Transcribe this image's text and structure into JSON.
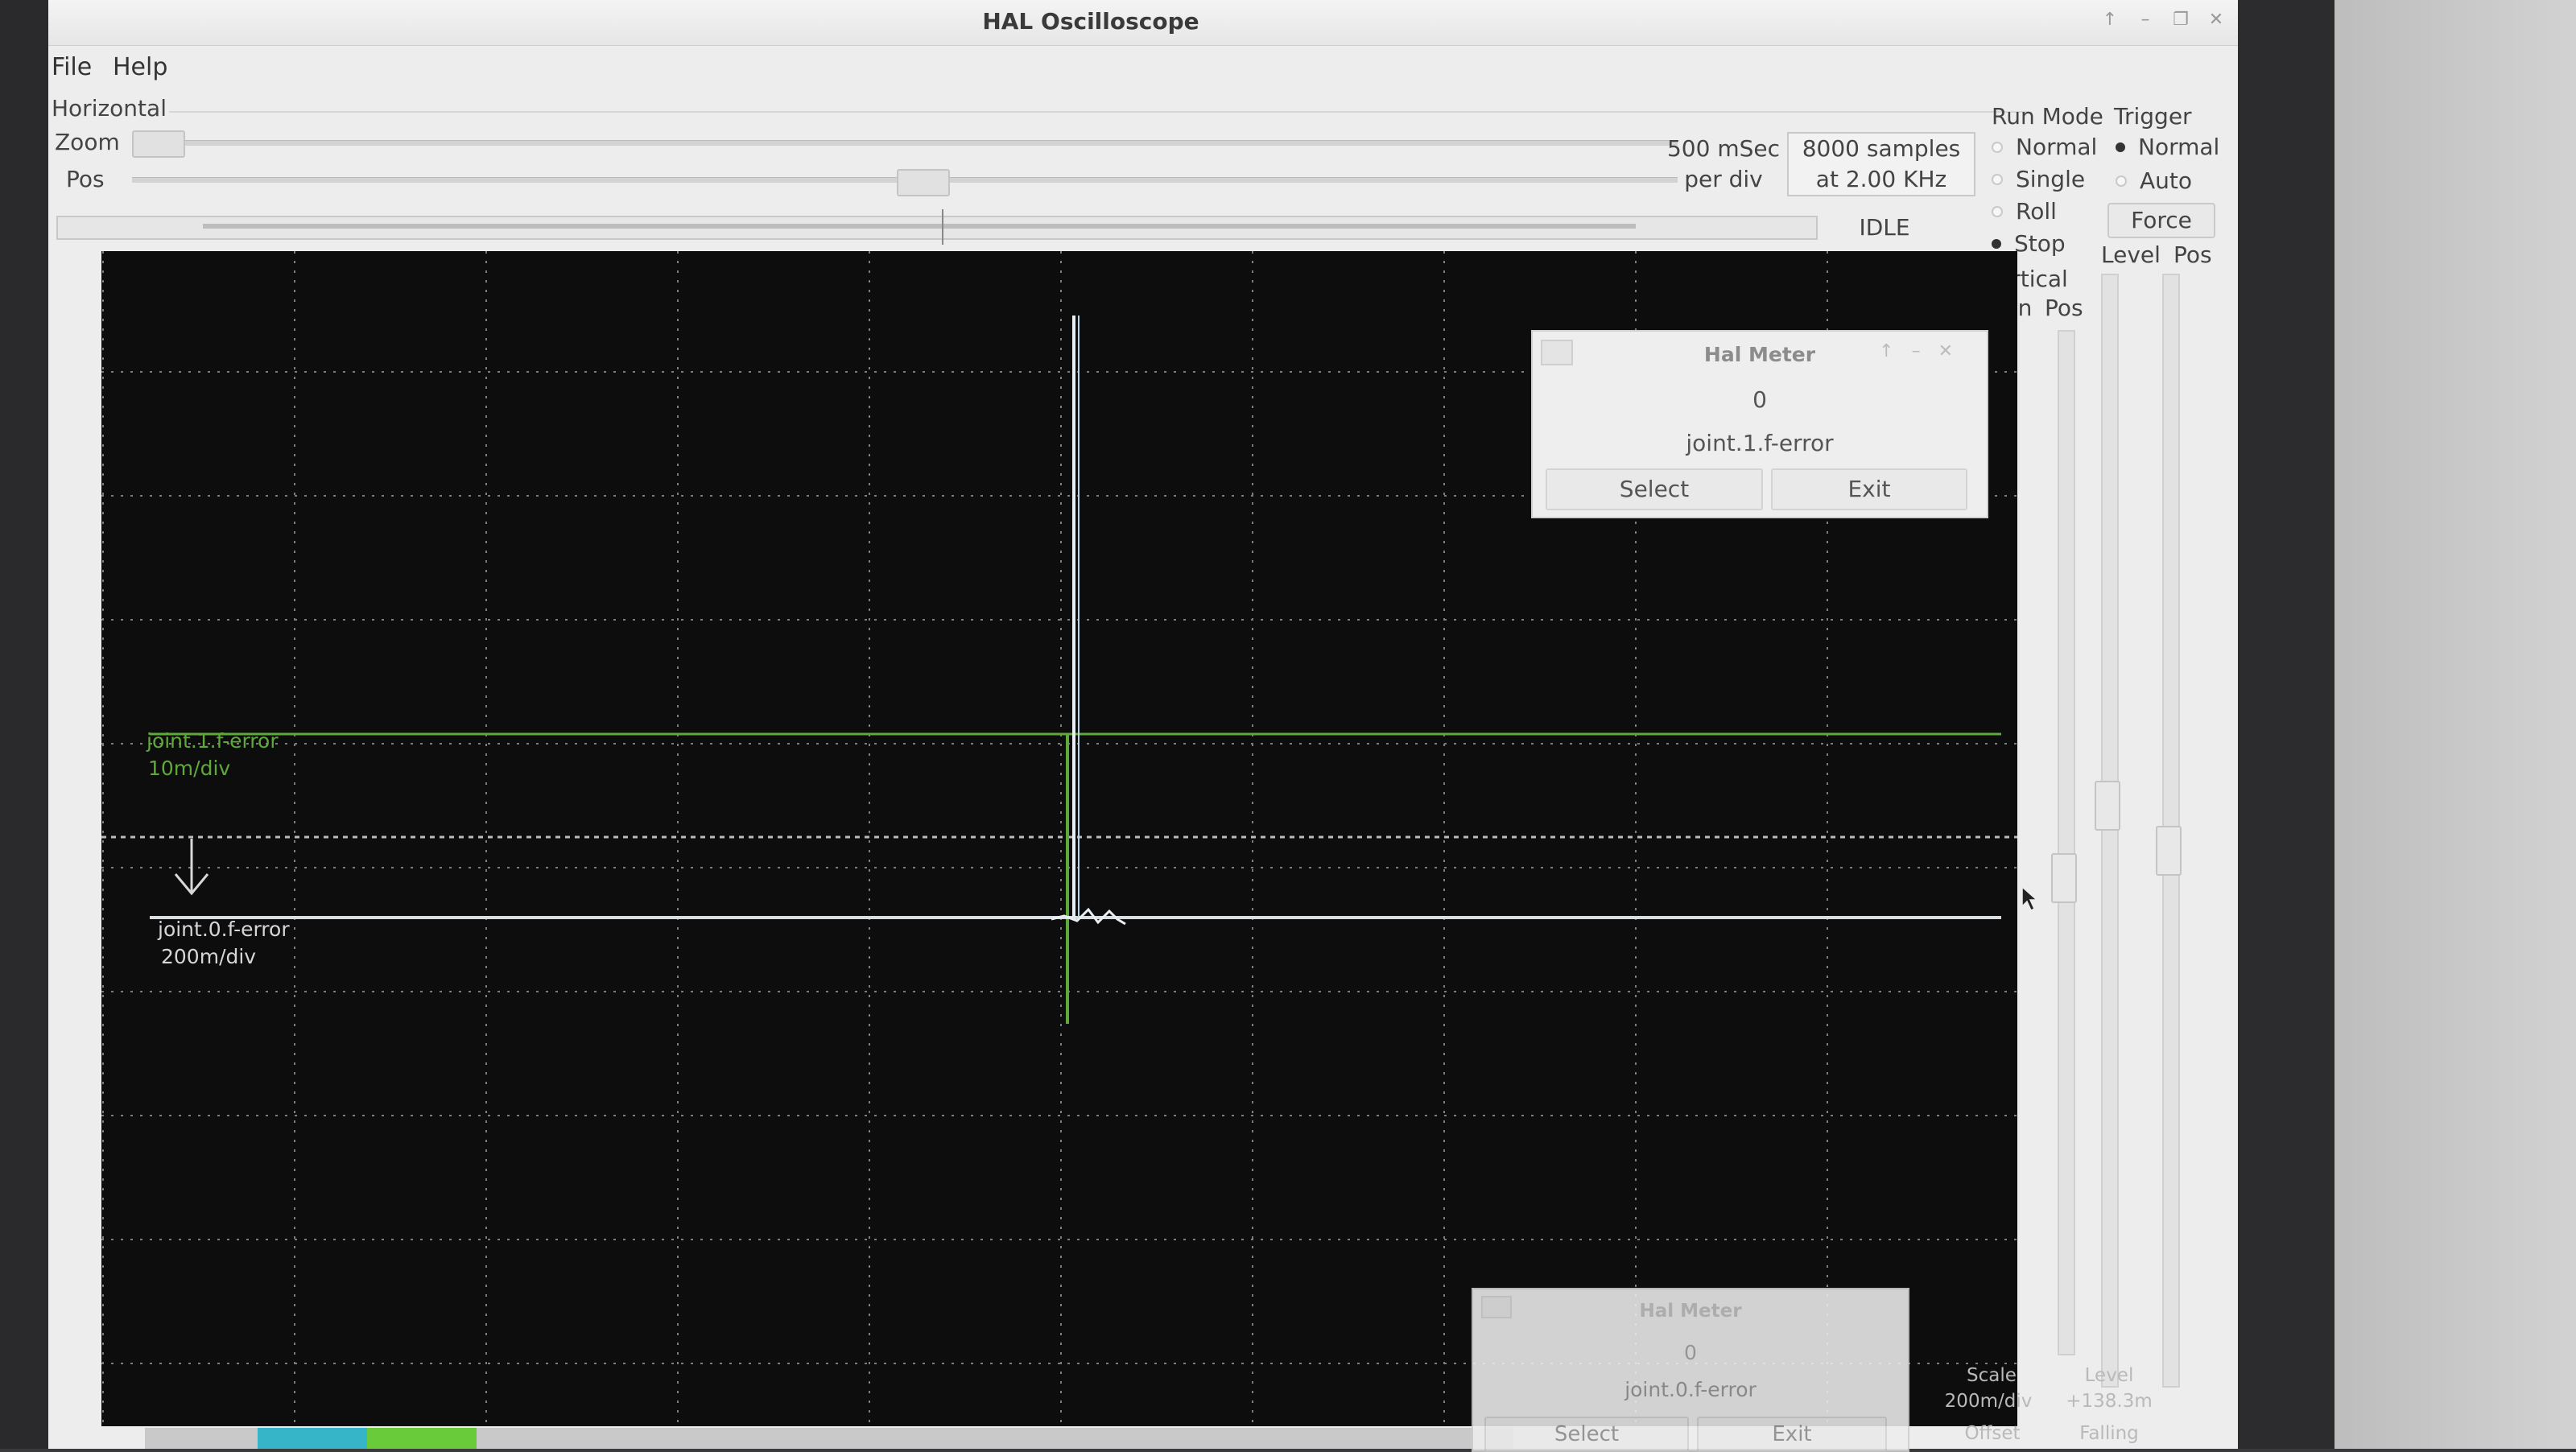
{
  "window": {
    "title": "HAL Oscilloscope",
    "controls": {
      "up": "↑",
      "minimize": "–",
      "maximize": "❐",
      "close": "✕"
    }
  },
  "menu": {
    "file": "File",
    "help": "Help"
  },
  "horizontal": {
    "label": "Horizontal",
    "zoom_label": "Zoom",
    "pos_label": "Pos",
    "timebase_line1": "500 mSec",
    "timebase_line2": "per div",
    "samples_line1": "8000 samples",
    "samples_line2": "at 2.00 KHz",
    "status": "IDLE"
  },
  "run_mode": {
    "label": "Run Mode",
    "options": [
      "Normal",
      "Single",
      "Roll",
      "Stop"
    ],
    "selected": "Stop"
  },
  "trigger": {
    "label": "Trigger",
    "options": [
      "Normal",
      "Auto"
    ],
    "selected": "Normal",
    "force_label": "Force",
    "level_label": "Level",
    "pos_label": "Pos"
  },
  "vertical": {
    "label": "Vertical",
    "gain_label": "Gain",
    "pos_label": "Pos"
  },
  "scope": {
    "channel1_name": "joint.1.f-error",
    "channel1_scale": "10m/div",
    "channel0_name": "joint.0.f-error",
    "channel0_scale": "200m/div",
    "colors": {
      "ch1": "#5fa83a",
      "ch0": "#d8dde0",
      "grid": "#9a9a9a"
    }
  },
  "meter1": {
    "title": "Hal Meter",
    "value": "0",
    "signal": "joint.1.f-error",
    "select_label": "Select",
    "exit_label": "Exit"
  },
  "meter2": {
    "title": "Hal Meter",
    "value": "0",
    "signal": "joint.0.f-error",
    "select_label": "Select",
    "exit_label": "Exit"
  },
  "bottom_right": {
    "scale_label": "Scale",
    "scale_value": "200m/div",
    "level_label": "Level",
    "level_value": "+138.3m",
    "offset_label": "Offset",
    "falling_label": "Falling"
  }
}
